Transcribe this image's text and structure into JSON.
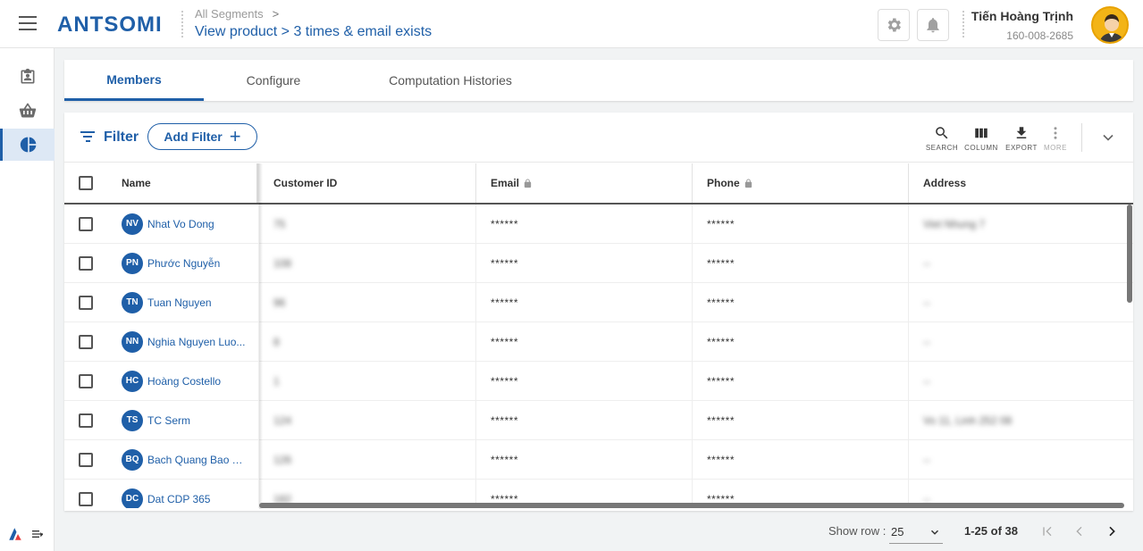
{
  "header": {
    "logo": "ANTSOMI",
    "breadcrumb": "All Segments",
    "breadcrumb_chevron": ">",
    "segment_title": "View product > 3 times & email exists",
    "settings_icon": "gear-icon",
    "notifications_icon": "bell-icon",
    "user_name": "Tiến Hoàng Trịnh",
    "user_phone": "160-008-2685"
  },
  "sidebar": {
    "items": [
      {
        "icon": "clipboard-user-icon"
      },
      {
        "icon": "basket-icon"
      },
      {
        "icon": "pie-chart-icon",
        "active": true
      }
    ]
  },
  "tabs": [
    "Members",
    "Configure",
    "Computation Histories"
  ],
  "filter": {
    "label": "Filter",
    "add_label": "Add Filter",
    "add_symbol": "+"
  },
  "tools": {
    "search": "SEARCH",
    "column": "COLUMN",
    "export": "EXPORT",
    "more": "MORE"
  },
  "table": {
    "columns": [
      "Name",
      "Customer ID",
      "Email",
      "Phone",
      "Address"
    ],
    "rows": [
      {
        "initials": "NV",
        "name": "Nhat Vo Dong",
        "customer_id": "75",
        "email": "******",
        "phone": "******",
        "address": "Viet Nhung 7"
      },
      {
        "initials": "PN",
        "name": "Phước Nguyễn",
        "customer_id": "108",
        "email": "******",
        "phone": "******",
        "address": "--"
      },
      {
        "initials": "TN",
        "name": "Tuan Nguyen",
        "customer_id": "96",
        "email": "******",
        "phone": "******",
        "address": "--"
      },
      {
        "initials": "NN",
        "name": "Nghia Nguyen Luo...",
        "customer_id": "8",
        "email": "******",
        "phone": "******",
        "address": "--"
      },
      {
        "initials": "HC",
        "name": "Hoàng Costello",
        "customer_id": "1",
        "email": "******",
        "phone": "******",
        "address": "--"
      },
      {
        "initials": "TS",
        "name": "TC Serm",
        "customer_id": "124",
        "email": "******",
        "phone": "******",
        "address": "Vo 11, Linh 252 08"
      },
      {
        "initials": "BQ",
        "name": "Bach Quang Bao T...",
        "customer_id": "126",
        "email": "******",
        "phone": "******",
        "address": "--"
      },
      {
        "initials": "DC",
        "name": "Dat CDP 365",
        "customer_id": "182",
        "email": "******",
        "phone": "******",
        "address": "--"
      }
    ]
  },
  "pagination": {
    "show_row_label": "Show row :",
    "rows_per_page": "25",
    "range": "1-25 of 38"
  },
  "colors": {
    "brand": "#1f5fa8",
    "avatar": "#f3b417"
  }
}
